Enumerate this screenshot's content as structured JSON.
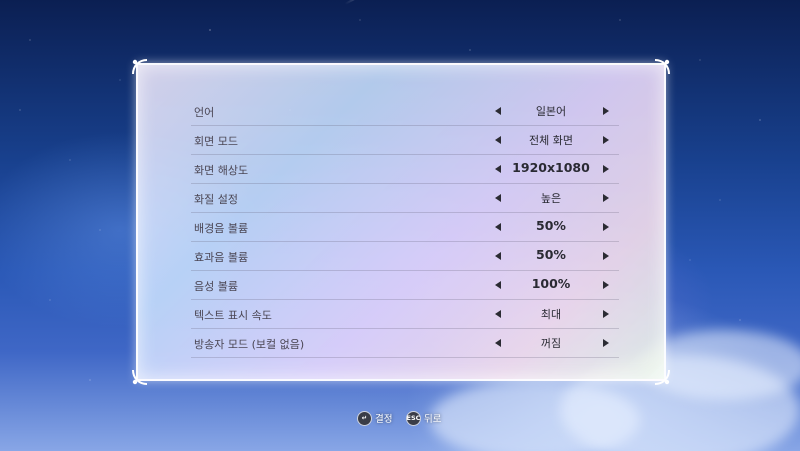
{
  "settings": [
    {
      "label": "언어",
      "value": "일본어"
    },
    {
      "label": "회면 모드",
      "value": "전체 화면"
    },
    {
      "label": "화면 해상도",
      "value": "1920x1080"
    },
    {
      "label": "화질 설정",
      "value": "높은"
    },
    {
      "label": "배경음 볼륨",
      "value": "50%"
    },
    {
      "label": "효과음 볼륨",
      "value": "50%"
    },
    {
      "label": "음성 볼륨",
      "value": "100%"
    },
    {
      "label": "텍스트 표시 속도",
      "value": "최대"
    },
    {
      "label": "방송자 모드 (보컬 없음)",
      "value": "꺼짐"
    }
  ],
  "footer": {
    "confirm_icon_glyph": "↵",
    "confirm_label": "결정",
    "back_icon_glyph": "ESC",
    "back_label": "뒤로"
  },
  "colors": {
    "label_text": "#4b4654",
    "value_text": "#2a2a33",
    "arrow": "#2b2b33",
    "panel_border": "#ffffff"
  },
  "icons": {
    "left_arrow": "left-triangle-icon",
    "right_arrow": "right-triangle-icon",
    "confirm": "enter-key-icon",
    "back": "esc-key-icon"
  }
}
